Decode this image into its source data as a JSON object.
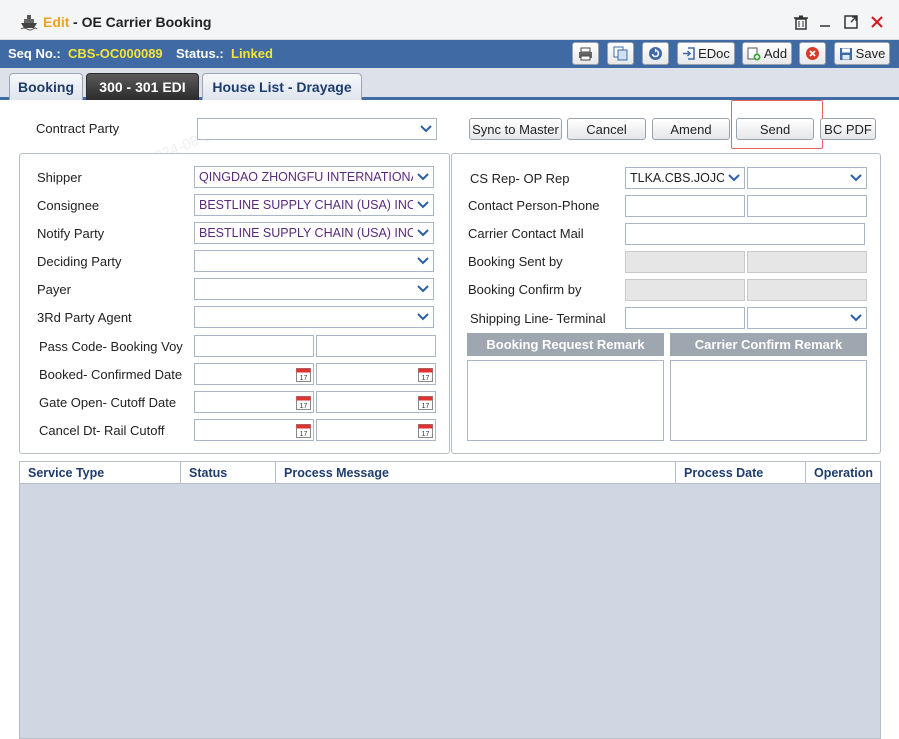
{
  "window": {
    "edit_label": "Edit",
    "title": "OE Carrier Booking"
  },
  "infobar": {
    "seq_label": "Seq No.:",
    "seq_value": "CBS-OC000089",
    "status_label": "Status.:",
    "status_value": "Linked",
    "edoc_label": "EDoc",
    "add_label": "Add",
    "save_label": "Save"
  },
  "tabs": [
    {
      "label": "Booking"
    },
    {
      "label": "300 - 301 EDI"
    },
    {
      "label": "House List - Drayage"
    }
  ],
  "actions": {
    "contract_party_label": "Contract Party",
    "sync_label": "Sync to Master",
    "cancel_label": "Cancel",
    "amend_label": "Amend",
    "send_label": "Send",
    "bcpdf_label": "BC PDF"
  },
  "left": {
    "shipper_label": "Shipper",
    "shipper_value": "QINGDAO ZHONGFU INTERNATIONAL",
    "consignee_label": "Consignee",
    "consignee_value": "BESTLINE SUPPLY CHAIN (USA) INC",
    "notify_label": "Notify Party",
    "notify_value": "BESTLINE SUPPLY CHAIN (USA) INC",
    "deciding_label": "Deciding Party",
    "payer_label": "Payer",
    "third_label": "3Rd Party Agent",
    "pass_label": "Pass Code- Booking Voy",
    "booked_label": "Booked- Confirmed Date",
    "gate_label": "Gate Open- Cutoff Date",
    "canceldt_label": "Cancel Dt- Rail Cutoff"
  },
  "right": {
    "csrep_label": "CS Rep- OP Rep",
    "csrep_value": "TLKA.CBS.JOJO",
    "contact_label": "Contact Person-Phone",
    "carriermail_label": "Carrier Contact Mail",
    "sentby_label": "Booking Sent by",
    "confirmby_label": "Booking Confirm by",
    "shipline_label": "Shipping Line- Terminal",
    "req_remark_label": "Booking Request Remark",
    "conf_remark_label": "Carrier Confirm Remark"
  },
  "grid": {
    "columns": [
      "Service Type",
      "Status",
      "Process Message",
      "Process Date",
      "Operation"
    ]
  },
  "calendar_glyph": "17",
  "watermark": "TLKA.CBS.TEST 2024-08-23"
}
